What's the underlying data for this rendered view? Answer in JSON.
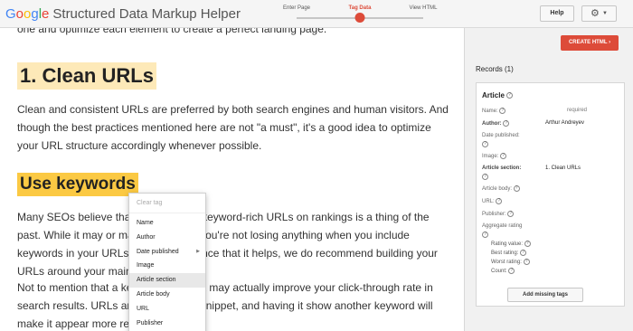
{
  "header": {
    "logo_google": [
      "G",
      "o",
      "o",
      "g",
      "l",
      "e"
    ],
    "logo_rest": "Structured Data Markup Helper",
    "steps": [
      "Enter Page",
      "Tag Data",
      "View HTML"
    ],
    "active_step": 1,
    "help_label": "Help",
    "gear_icon": "gear-icon"
  },
  "article": {
    "cut_line": "one and optimize each element to create a perfect landing page.",
    "h1": "1. Clean URLs",
    "para1": "Clean and consistent URLs are preferred by both search engines and human visitors. And though the best practices mentioned here are not \"a must\", it's a good idea to optimize your URL structure accordingly whenever possible.",
    "h2": "Use keywords",
    "para2": "Many SEOs believe that the impact of keyword-rich URLs on rankings is a thing of the past. While it may or may not be true, you're not losing anything when you include keywords in your URLs. So, at the chance that it helps, we do recommend building your URLs around your main keywords.",
    "para3": "Not to mention that a keyword in a URL may actually improve your click-through rate in search results. URLs are a part of the snippet, and having it show another keyword will make it appear more relevant:"
  },
  "menu": {
    "clear": "Clear tag",
    "items": [
      "Name",
      "Author",
      "Date published",
      "Image",
      "Article section",
      "Article body",
      "URL",
      "Publisher"
    ],
    "highlighted": 4,
    "submenu_index": 2
  },
  "sidebar": {
    "create_label": "CREATE HTML",
    "create_icon": "chevron-right-icon",
    "records_title": "Records (1)",
    "card_title": "Article",
    "fields": {
      "name_label": "Name:",
      "name_required": "required",
      "author_label": "Author:",
      "author_value": "Arthur Andreyev",
      "date_label": "Date published:",
      "image_label": "Image:",
      "section_label": "Article section:",
      "section_value": "1. Clean URLs",
      "body_label": "Article body:",
      "url_label": "URL:",
      "publisher_label": "Publisher:",
      "aggregate_label": "Aggregate rating",
      "rating_value": "Rating value:",
      "best_rating": "Best rating:",
      "worst_rating": "Worst rating:",
      "count": "Count:"
    },
    "add_missing": "Add missing tags"
  },
  "colors": {
    "accent": "#dd4b39",
    "h1_highlight": "#fde9b8",
    "h2_highlight": "#fbc943"
  }
}
